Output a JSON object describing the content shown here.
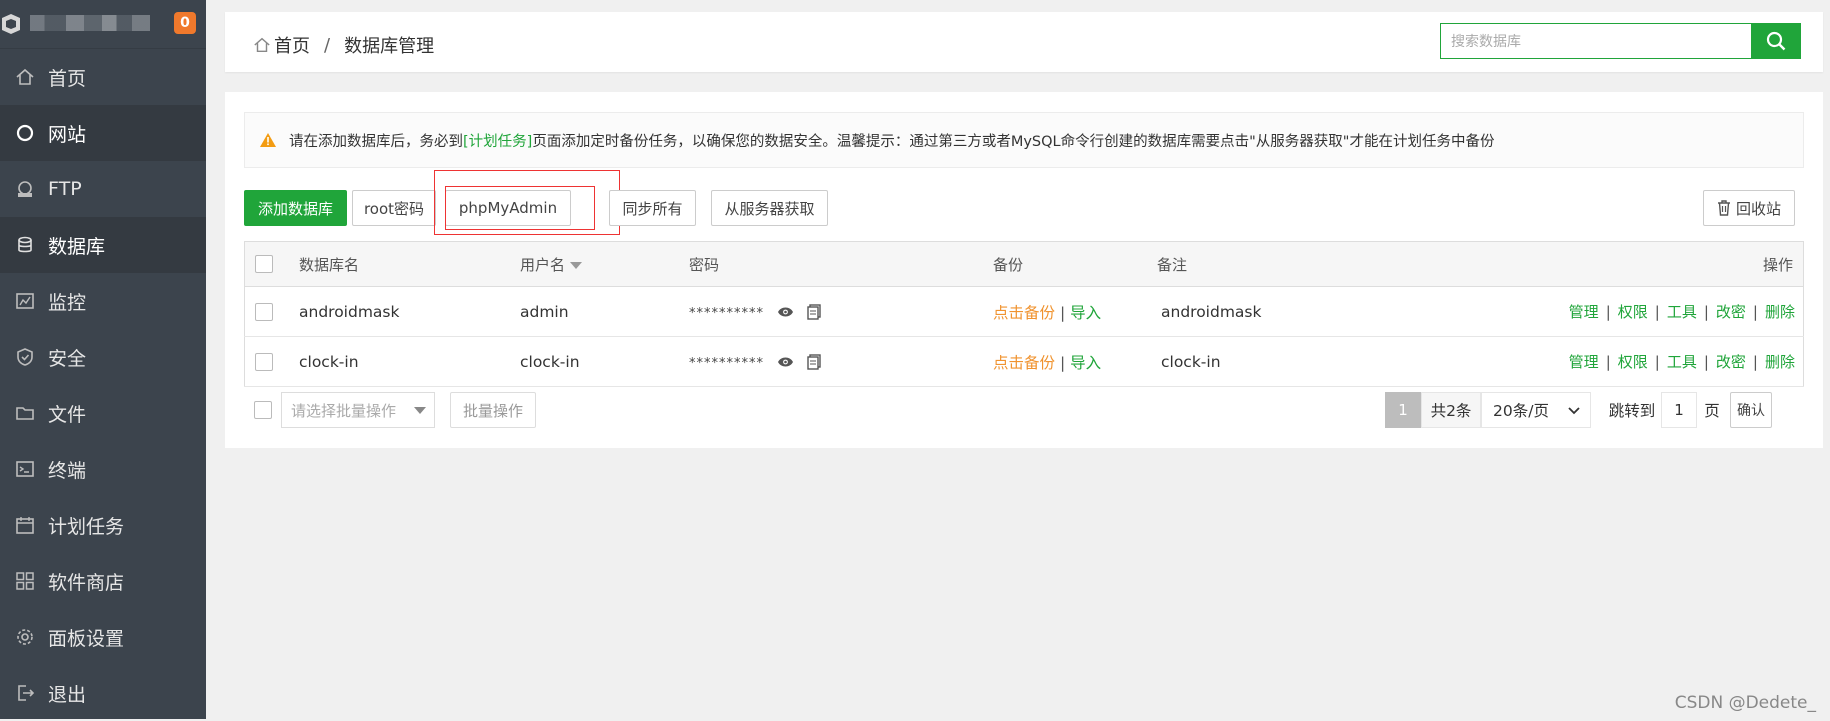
{
  "sidebar": {
    "badge": "0",
    "items": [
      {
        "label": "首页",
        "icon": "home-icon"
      },
      {
        "label": "网站",
        "icon": "globe-icon"
      },
      {
        "label": "FTP",
        "icon": "ftp-icon"
      },
      {
        "label": "数据库",
        "icon": "database-icon"
      },
      {
        "label": "监控",
        "icon": "monitor-icon"
      },
      {
        "label": "安全",
        "icon": "shield-icon"
      },
      {
        "label": "文件",
        "icon": "folder-icon"
      },
      {
        "label": "终端",
        "icon": "terminal-icon"
      },
      {
        "label": "计划任务",
        "icon": "calendar-icon"
      },
      {
        "label": "软件商店",
        "icon": "apps-icon"
      },
      {
        "label": "面板设置",
        "icon": "gear-icon"
      },
      {
        "label": "退出",
        "icon": "logout-icon"
      }
    ]
  },
  "header": {
    "crumb_home": "首页",
    "crumb_sep": "/",
    "crumb_current": "数据库管理",
    "search_placeholder": "搜索数据库"
  },
  "notice": {
    "prefix": "请在添加数据库后，务必到",
    "link": "[计划任务]",
    "suffix": "页面添加定时备份任务，以确保您的数据安全。温馨提示：通过第三方或者MySQL命令行创建的数据库需要点击\"从服务器获取\"才能在计划任务中备份"
  },
  "toolbar": {
    "add": "添加数据库",
    "root_pwd": "root密码",
    "phpmyadmin": "phpMyAdmin",
    "sync_all": "同步所有",
    "fetch_server": "从服务器获取",
    "recycle": "回收站"
  },
  "table": {
    "headers": {
      "name": "数据库名",
      "user": "用户名",
      "pwd": "密码",
      "backup": "备份",
      "note": "备注",
      "ops": "操作"
    },
    "rows": [
      {
        "name": "androidmask",
        "user": "admin",
        "pwd": "**********",
        "backup": "点击备份",
        "import": "导入",
        "note": "androidmask"
      },
      {
        "name": "clock-in",
        "user": "clock-in",
        "pwd": "**********",
        "backup": "点击备份",
        "import": "导入",
        "note": "clock-in"
      }
    ],
    "ops": {
      "manage": "管理",
      "perm": "权限",
      "tools": "工具",
      "changepwd": "改密",
      "delete": "删除",
      "sep": "|"
    }
  },
  "footer": {
    "batch_placeholder": "请选择批量操作",
    "batch_btn": "批量操作",
    "current_page": "1",
    "total": "共2条",
    "per_page": "20条/页",
    "jump_label": "跳转到",
    "jump_value": "1",
    "page_unit": "页",
    "confirm": "确认"
  },
  "watermark": "CSDN @Dedete_",
  "colors": {
    "accent": "#20a53a",
    "sidebar": "#3c444d",
    "backup_link": "#f0932f",
    "badge": "#f0792c",
    "highlight_box": "#ee3333"
  }
}
